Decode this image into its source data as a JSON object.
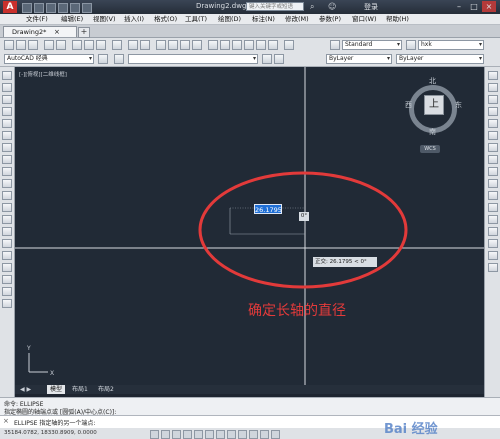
{
  "app": {
    "document_title": "Drawing2.dwg",
    "search_placeholder": "键入关键字或短语",
    "login_label": "登录",
    "window_buttons": [
      "–",
      "□",
      "×"
    ]
  },
  "menubar": {
    "items": [
      "文件(F)",
      "编辑(E)",
      "视图(V)",
      "插入(I)",
      "格式(O)",
      "工具(T)",
      "绘图(D)",
      "标注(N)",
      "修改(M)",
      "参数(P)",
      "窗口(W)",
      "帮助(H)"
    ]
  },
  "tabs": {
    "active_tab": "Drawing2*",
    "close_icon": "×",
    "new_tab_icon": "+"
  },
  "toolbar": {
    "text_style": "Standard",
    "dim_style": "Standard",
    "table_style": "hxk",
    "workspace": "AutoCAD 经典",
    "color": "ByLayer",
    "linetype": "ByLayer",
    "lineweight": "ByLayer"
  },
  "viewport": {
    "label": "[-][俯视][二维线框]",
    "compass": {
      "north": "北",
      "south": "南",
      "west": "西",
      "east": "东",
      "face": "上"
    },
    "wcs_label": "WCS"
  },
  "drawing": {
    "dynamic_value": "26.1795",
    "angle_value": "0°",
    "polar_tooltip": "正交: 26.1795 < 0°",
    "annotation": "确定长轴的直径"
  },
  "layout_tabs": [
    "模型",
    "布局1",
    "布局2"
  ],
  "command": {
    "history": [
      "命令:   ELLIPSE",
      "指定椭圆的轴端点或 [圆弧(A)/中心点(C)]:"
    ],
    "input_prompt": "ELLIPSE 指定轴的另一个端点:"
  },
  "status": {
    "coordinates": "35184.0782, 18330.8909, 0.0000"
  },
  "watermark": "Bai 经验",
  "colors": {
    "canvas": "#212a36",
    "annotation_red": "#e23a3a",
    "input_blue": "#1f6fd6"
  }
}
